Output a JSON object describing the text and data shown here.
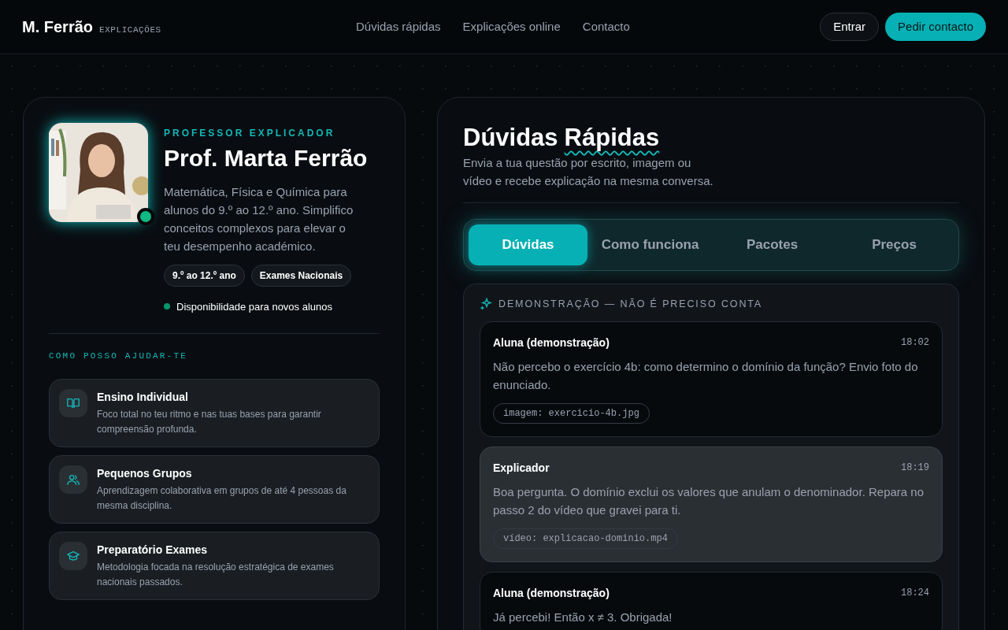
{
  "header": {
    "logo": "M. Ferrão",
    "logo_tag": "EXPLICAÇÕES",
    "nav": [
      "Dúvidas rápidas",
      "Explicações online",
      "Contacto"
    ],
    "login": "Entrar",
    "cta": "Pedir contacto"
  },
  "profile": {
    "online": true,
    "eyebrow": "PROFESSOR EXPLICADOR",
    "name": "Prof. Marta Ferrão",
    "bio": "Matemática, Física e Química para alunos do 9.º ao 12.º ano. Simplifico conceitos complexos para elevar o teu desempenho académico.",
    "tags": [
      "9.º ao 12.º ano",
      "Exames Nacionais"
    ],
    "availability": {
      "color": "#059669",
      "text": "Disponibilidade para novos alunos"
    }
  },
  "services": {
    "heading": "COMO POSSO AJUDAR-TE",
    "items": [
      {
        "kind": "book",
        "title": "Ensino Individual",
        "text": "Foco total no teu ritmo e nas tuas bases para garantir compreensão profunda."
      },
      {
        "kind": "users",
        "title": "Pequenos Grupos",
        "text": "Aprendizagem colaborativa em grupos de até 4 pessoas da mesma disciplina."
      },
      {
        "kind": "cap",
        "title": "Preparatório Exames",
        "text": "Metodologia focada na resolução estratégica de exames nacionais passados."
      }
    ]
  },
  "panel": {
    "title": "Dúvidas",
    "title_highlight": "Rápidas",
    "subtitle": "Envia a tua questão por escrito, imagem ou vídeo e recebe explicação na mesma conversa.",
    "tabs": [
      {
        "label": "Dúvidas",
        "selected": true
      },
      {
        "label": "Como funciona",
        "selected": false
      },
      {
        "label": "Pacotes",
        "selected": false
      },
      {
        "label": "Preços",
        "selected": false
      }
    ],
    "demo_label": "DEMONSTRAÇÃO — NÃO É PRECISO CONTA",
    "messages": [
      {
        "kind": "student",
        "author": "Aluna (demonstração)",
        "time": "18:02",
        "text": "Não percebo o exercício 4b: como determino o domínio da função? Envio foto do enunciado.",
        "attachment": "imagem: exercicio-4b.jpg"
      },
      {
        "kind": "tutor",
        "author": "Explicador",
        "time": "18:19",
        "text": "Boa pergunta. O domínio exclui os valores que anulam o denominador. Repara no passo 2 do vídeo que gravei para ti.",
        "attachment": "vídeo: explicacao-dominio.mp4"
      },
      {
        "kind": "student",
        "author": "Aluna (demonstração)",
        "time": "18:24",
        "text": "Já percebi! Então x ≠ 3. Obrigada!"
      }
    ]
  }
}
